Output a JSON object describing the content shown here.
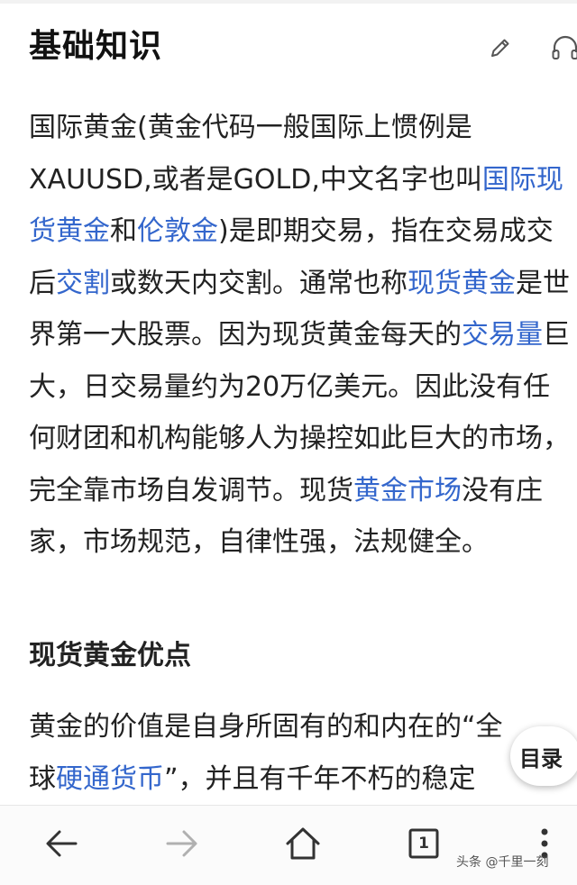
{
  "section": {
    "title": "基础知识",
    "edit_icon": "pencil-icon",
    "listen_icon": "headphones-icon"
  },
  "article": {
    "t1": "国际黄金(黄金代码一般国际上惯例是XAUUSD,或者是GOLD,中文名字也叫",
    "link_spot_gold_intl": "国际现货黄金",
    "t2": "和",
    "link_london_gold": "伦敦金",
    "t3": ")是即期交易，指在交易成交后",
    "link_delivery": "交割",
    "t4": "或数天内交割。通常也称",
    "link_spot_gold": "现货黄金",
    "t5": "是世界第一大股票。因为现货黄金每天的",
    "link_volume": "交易量",
    "t6": "巨大，日交易量约为20万亿美元。因此没有任何财团和机构能够人为操控如此巨大的市场，完全靠市场自发调节。现货",
    "link_gold_market": "黄金市场",
    "t7": "没有庄家，市场规范，自律性强，法规健全。"
  },
  "section2": {
    "title": "现货黄金优点"
  },
  "article2": {
    "line1": "黄金的价值是自身所固有的和内在的“全",
    "line2_prefix": "球",
    "link_hard_currency": "硬通货币",
    "line2_suffix": "”，并且有千年不朽的稳定"
  },
  "toc": {
    "label": "目录"
  },
  "bottom_nav": {
    "back_icon": "arrow-left-icon",
    "forward_icon": "arrow-right-icon",
    "home_icon": "home-icon",
    "tabs_icon": "tabs-icon",
    "tabs_count": "1",
    "menu_icon": "more-vertical-icon"
  },
  "watermark": {
    "text": "头条 @千里一刻"
  },
  "colors": {
    "link": "#3366cc",
    "text": "#222222",
    "disabled": "#b0b0b0"
  }
}
